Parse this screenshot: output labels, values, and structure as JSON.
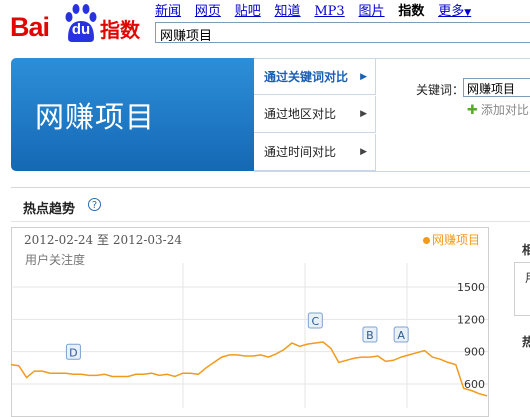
{
  "logo": {
    "bai": "Bai",
    "du": "du",
    "zhishu": "指数"
  },
  "nav": {
    "items": [
      {
        "label": "新闻"
      },
      {
        "label": "网页"
      },
      {
        "label": "贴吧"
      },
      {
        "label": "知道"
      },
      {
        "label": "MP3"
      },
      {
        "label": "图片"
      }
    ],
    "current": "指数",
    "more": "更多",
    "more_arrow": "▼"
  },
  "search": {
    "value": "网赚项目"
  },
  "banner": {
    "title": "网赚项目"
  },
  "compare_tabs": [
    {
      "label": "通过关键词对比",
      "active": true
    },
    {
      "label": "通过地区对比",
      "active": false
    },
    {
      "label": "通过时间对比",
      "active": false
    }
  ],
  "arrow_glyph": "▶",
  "keyword": {
    "label": "关键词：",
    "value": "网赚项目",
    "add_label": "添加对比",
    "add_glyph": "✚"
  },
  "trend": {
    "title": "热点趋势",
    "help_glyph": "?"
  },
  "chart_data": {
    "type": "line",
    "date_range": "2012-02-24 至 2012-03-24",
    "ylabel": "用户关注度",
    "legend": "网赚项目",
    "yticks": [
      "1500",
      "1200",
      "900",
      "600"
    ],
    "ylim": [
      350,
      1800
    ],
    "series": [
      {
        "name": "网赚项目",
        "color": "#f29a1e",
        "values": [
          780,
          770,
          660,
          720,
          720,
          700,
          700,
          700,
          690,
          690,
          680,
          680,
          690,
          670,
          670,
          670,
          690,
          690,
          700,
          680,
          690,
          670,
          700,
          700,
          690,
          750,
          800,
          850,
          870,
          870,
          860,
          860,
          870,
          850,
          880,
          920,
          980,
          950,
          970,
          980,
          990,
          930,
          800,
          820,
          840,
          850,
          850,
          860,
          810,
          820,
          850,
          870,
          890,
          910,
          850,
          830,
          800,
          780,
          560,
          540,
          510,
          490
        ]
      }
    ],
    "annotations": [
      {
        "label": "D",
        "index": 8
      },
      {
        "label": "C",
        "index": 39
      },
      {
        "label": "B",
        "index": 46
      },
      {
        "label": "A",
        "index": 50
      }
    ]
  },
  "right_edge": {
    "glyph1": "相",
    "glyph2": "用",
    "glyph3": "热"
  }
}
